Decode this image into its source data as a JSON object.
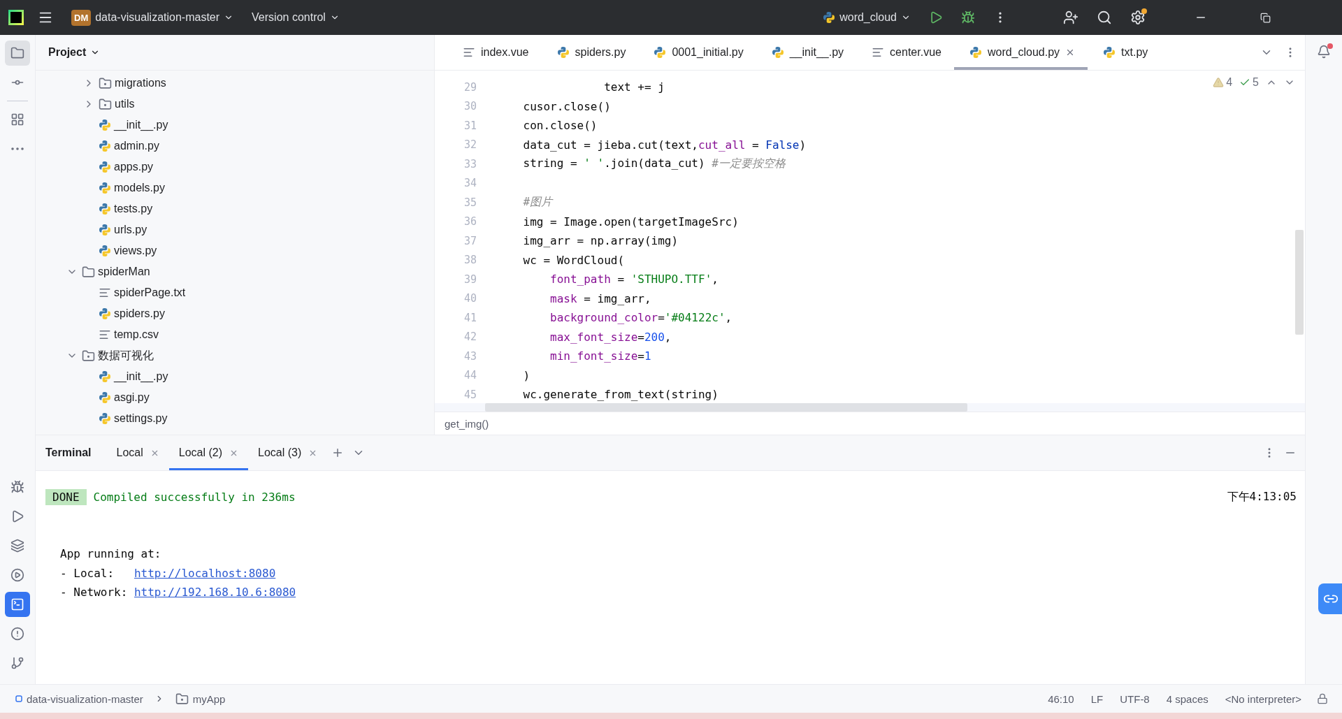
{
  "title_bar": {
    "project_badge": "DM",
    "project": "data-visualization-master",
    "vcs": "Version control",
    "run_config": "word_cloud"
  },
  "left_tools_top": [
    {
      "kind": "project",
      "selected": true
    },
    {
      "kind": "commit",
      "selected": false
    },
    {
      "kind": "structure",
      "selected": false
    },
    {
      "kind": "more",
      "selected": false
    }
  ],
  "left_tools_bottom": [
    {
      "kind": "python",
      "selected": false
    },
    {
      "kind": "run",
      "selected": false
    },
    {
      "kind": "layers",
      "selected": false
    },
    {
      "kind": "services",
      "selected": false
    },
    {
      "kind": "terminal",
      "selected": true
    },
    {
      "kind": "problems",
      "selected": false
    },
    {
      "kind": "git",
      "selected": false
    }
  ],
  "project_panel": {
    "title": "Project",
    "tree": [
      {
        "children": [
          {
            "name": "migrations",
            "kind": "package",
            "expanded": false
          },
          {
            "name": "utils",
            "kind": "package",
            "expanded": false
          },
          {
            "name": "__init__.py",
            "kind": "py"
          },
          {
            "name": "admin.py",
            "kind": "py"
          },
          {
            "name": "apps.py",
            "kind": "py"
          },
          {
            "name": "models.py",
            "kind": "py"
          },
          {
            "name": "tests.py",
            "kind": "py"
          },
          {
            "name": "urls.py",
            "kind": "py"
          },
          {
            "name": "views.py",
            "kind": "py"
          }
        ]
      },
      {
        "name": "spiderMan",
        "kind": "folder",
        "expanded": true,
        "children": [
          {
            "name": "spiderPage.txt",
            "kind": "txt"
          },
          {
            "name": "spiders.py",
            "kind": "py"
          },
          {
            "name": "temp.csv",
            "kind": "txt"
          }
        ]
      },
      {
        "name": "数据可视化",
        "kind": "package",
        "expanded": true,
        "children": [
          {
            "name": "__init__.py",
            "kind": "py"
          },
          {
            "name": "asgi.py",
            "kind": "py"
          },
          {
            "name": "settings.py",
            "kind": "py"
          }
        ]
      }
    ]
  },
  "editor_tabs": [
    {
      "label": "index.vue",
      "kind": "txt",
      "selected": false
    },
    {
      "label": "spiders.py",
      "kind": "py",
      "selected": false
    },
    {
      "label": "0001_initial.py",
      "kind": "py",
      "selected": false
    },
    {
      "label": "__init__.py",
      "kind": "py",
      "selected": false
    },
    {
      "label": "center.vue",
      "kind": "txt",
      "selected": false
    },
    {
      "label": "word_cloud.py",
      "kind": "py",
      "selected": true
    },
    {
      "label": "txt.py",
      "kind": "py",
      "selected": false
    }
  ],
  "inspections": {
    "warnings": "4",
    "typos": "5"
  },
  "code": [
    {
      "number": "29",
      "tokens": [
        {
          "text": "                text += j",
          "kind": "plain"
        }
      ]
    },
    {
      "number": "30",
      "tokens": [
        {
          "text": "    cusor.close()",
          "kind": "plain"
        }
      ]
    },
    {
      "number": "31",
      "tokens": [
        {
          "text": "    con.close()",
          "kind": "plain"
        }
      ]
    },
    {
      "number": "32",
      "tokens": [
        {
          "text": "    data_cut = jieba.cut(text,",
          "kind": "plain"
        },
        {
          "text": "cut_all",
          "kind": "param"
        },
        {
          "text": " = ",
          "kind": "plain"
        },
        {
          "text": "False",
          "kind": "keyword"
        },
        {
          "text": ")",
          "kind": "plain"
        }
      ]
    },
    {
      "number": "33",
      "tokens": [
        {
          "text": "    string = ",
          "kind": "plain"
        },
        {
          "text": "' '",
          "kind": "string"
        },
        {
          "text": ".join(data_cut) ",
          "kind": "plain"
        },
        {
          "text": "#一定要按空格",
          "kind": "comment"
        }
      ]
    },
    {
      "number": "34"
    },
    {
      "number": "35",
      "tokens": [
        {
          "text": "    #图片",
          "kind": "comment"
        }
      ]
    },
    {
      "number": "36",
      "tokens": [
        {
          "text": "    img = Image.open(targetImageSrc)",
          "kind": "plain"
        }
      ]
    },
    {
      "number": "37",
      "tokens": [
        {
          "text": "    img_arr = np.array(img)",
          "kind": "plain"
        }
      ]
    },
    {
      "number": "38",
      "tokens": [
        {
          "text": "    wc = WordCloud(",
          "kind": "plain"
        }
      ]
    },
    {
      "number": "39",
      "tokens": [
        {
          "text": "        font_path",
          "kind": "param"
        },
        {
          "text": " = ",
          "kind": "plain"
        },
        {
          "text": "'STHUPO.TTF'",
          "kind": "string"
        },
        {
          "text": ",",
          "kind": "plain"
        }
      ]
    },
    {
      "number": "40",
      "tokens": [
        {
          "text": "        mask",
          "kind": "param"
        },
        {
          "text": " = img_arr,",
          "kind": "plain"
        }
      ]
    },
    {
      "number": "41",
      "tokens": [
        {
          "text": "        background_color",
          "kind": "param"
        },
        {
          "text": "=",
          "kind": "plain"
        },
        {
          "text": "'#04122c'",
          "kind": "string"
        },
        {
          "text": ",",
          "kind": "plain"
        }
      ]
    },
    {
      "number": "42",
      "tokens": [
        {
          "text": "        max_font_size",
          "kind": "param"
        },
        {
          "text": "=",
          "kind": "plain"
        },
        {
          "text": "200",
          "kind": "number"
        },
        {
          "text": ",",
          "kind": "plain"
        }
      ]
    },
    {
      "number": "43",
      "tokens": [
        {
          "text": "        min_font_size",
          "kind": "param"
        },
        {
          "text": "=",
          "kind": "plain"
        },
        {
          "text": "1",
          "kind": "number"
        }
      ]
    },
    {
      "number": "44",
      "tokens": [
        {
          "text": "    )",
          "kind": "plain"
        }
      ]
    },
    {
      "number": "45",
      "tokens": [
        {
          "text": "    wc.generate_from_text(string)",
          "kind": "plain"
        }
      ]
    }
  ],
  "editor_breadcrumb": "get_img()",
  "terminal": {
    "title": "Terminal",
    "tabs": [
      {
        "label": "Local",
        "selected": false
      },
      {
        "label": "Local (2)",
        "selected": true
      },
      {
        "label": "Local (3)",
        "selected": false
      }
    ],
    "status_badge": "DONE",
    "status_message": "Compiled successfully in 236ms",
    "time": "下午4:13:05",
    "lines": [
      {
        "label": "App running at:"
      },
      {
        "label": "- Local:   ",
        "link": "http://localhost:8080"
      },
      {
        "label": "- Network: ",
        "link": "http://192.168.10.6:8080"
      }
    ]
  },
  "status_bar": {
    "breadcrumb": [
      {
        "label": "data-visualization-master",
        "kind": "project"
      },
      {
        "label": "myApp",
        "kind": "package"
      }
    ],
    "items": [
      "46:10",
      "LF",
      "UTF-8",
      "4 spaces",
      "<No interpreter>"
    ]
  }
}
